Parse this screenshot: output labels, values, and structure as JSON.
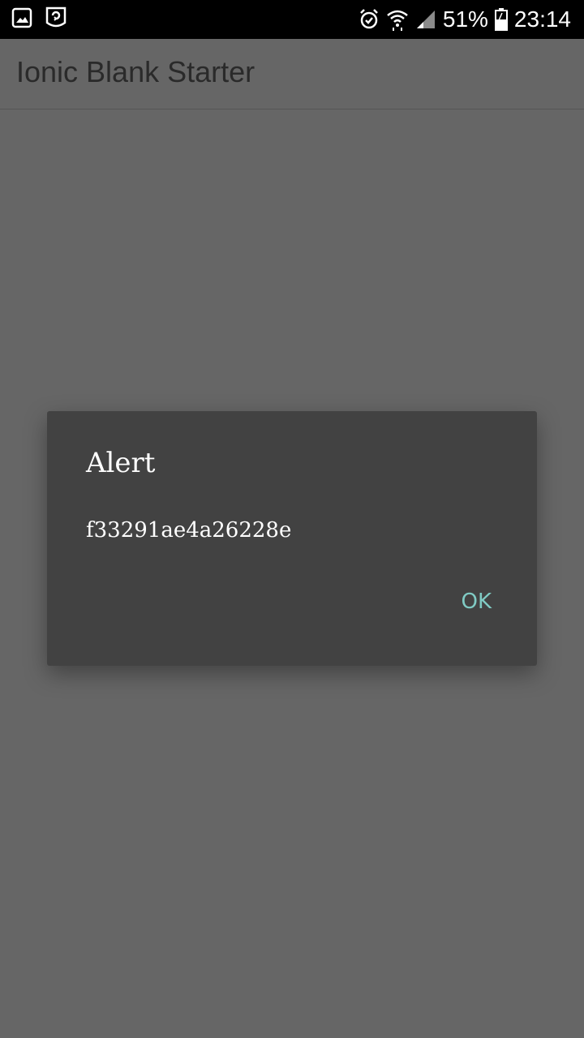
{
  "status_bar": {
    "battery_percent": "51%",
    "time": "23:14",
    "icons": [
      "gallery-icon",
      "screen-recorder-icon",
      "alarm-icon",
      "wifi-icon",
      "signal-icon",
      "battery-icon"
    ]
  },
  "header": {
    "title": "Ionic Blank Starter"
  },
  "dialog": {
    "title": "Alert",
    "message": "f33291ae4a26228e",
    "ok_label": "OK"
  },
  "colors": {
    "status_bar_bg": "#000000",
    "backdrop": "#666666",
    "dialog_bg": "#424242",
    "accent": "#80cbc4"
  }
}
